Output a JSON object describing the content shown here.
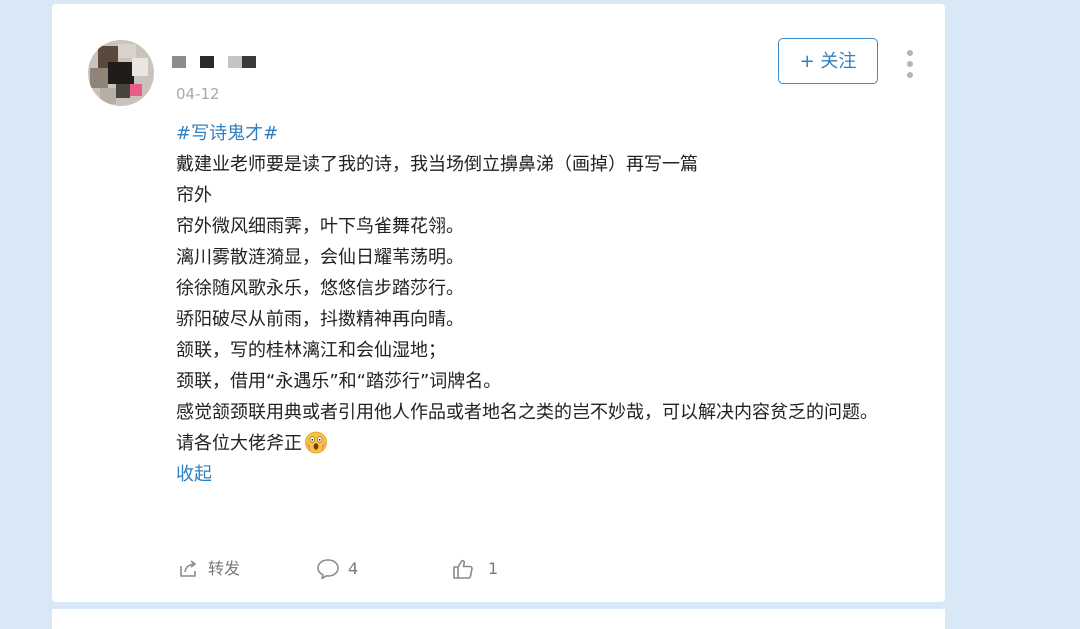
{
  "post": {
    "date": "04-12",
    "follow_label": "+ 关注",
    "hashtag": "#写诗鬼才#",
    "lines": [
      "戴建业老师要是读了我的诗，我当场倒立擤鼻涕（画掉）再写一篇",
      "帘外",
      "帘外微风细雨霁，叶下鸟雀舞花翎。",
      "漓川雾散涟漪显，会仙日耀苇荡明。",
      "徐徐随风歌永乐，悠悠信步踏莎行。",
      "骄阳破尽从前雨，抖擞精神再向晴。",
      "颔联，写的桂林漓江和会仙湿地；",
      "颈联，借用“永遇乐”和“踏莎行”词牌名。",
      "感觉颔颈联用典或者引用他人作品或者地名之类的岂不妙哉，可以解决内容贫乏的问题。",
      "请各位大佬斧正"
    ],
    "emoji": "screaming-face-emoji",
    "collapse_label": "收起"
  },
  "actions": {
    "repost_label": "转发",
    "comment_count": "4",
    "like_count": "1"
  },
  "colors": {
    "accent": "#2f7fbf",
    "background": "#d9e8f7",
    "text": "#222222",
    "muted": "#a8a8a8"
  }
}
